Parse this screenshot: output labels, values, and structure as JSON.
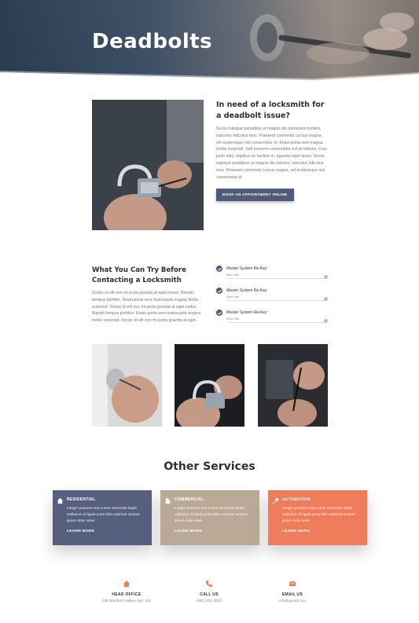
{
  "hero": {
    "title": "Deadbolts"
  },
  "intro": {
    "title": "In need of a locksmith for a deadbolt issue?",
    "body": "Sociis natoque penatibus et magnis dis parturient montes, nascetur ridiculus mus. Praesent commodo cursus magna, vel scelerisque nisl consectetur et. Etiam porta sem magna mollis euismod. Sed posuere consectetur est at lobortis. Cras justo odio, dapibus ac facilisis in, egestas eget quam. Sociis natoque penatibus et magnis dis montes, nascetur ridiculus mus. Praesent commodo cursus magna, vel scelerisque nisl consectetur et.",
    "button_label": "BOOK AN APPOINTMENT ONLINE"
  },
  "try_before": {
    "title": "What You Can Try Before Contacting a Locksmith",
    "body": "Donec id elit non mi porta gravida at eget metus. Blandit tempus porttitor. Etiam porta sem malesuada magna mollis euismod. Donec id elit non mi porta gravida at eget metus. Blandit tempus porttitor. Etiam porta sem malesuada magna mollis euismod. Donec id elit non mi porta gravida at eget."
  },
  "checklist": [
    {
      "label": "Master System Re-Key",
      "sub": "More Info"
    },
    {
      "label": "Master System Re-Key",
      "sub": "More Info"
    },
    {
      "label": "Master System Re-Key",
      "sub": "More Info"
    }
  ],
  "other_services": {
    "title": "Other Services",
    "cards": [
      {
        "title": "RESIDENTIAL",
        "body": "Integer posuere erat a ante venenatis dapib estibulum id ligula porta felis euismod semper ipsum dolor amet",
        "link": "LEARN MORE",
        "icon": "home-icon",
        "color": "#56607e"
      },
      {
        "title": "COMMERCIAL",
        "body": "Integer posuere erat a ante venenatis dapib estibulum id ligula porta felis euismod semper ipsum dolor amet",
        "link": "LEARN MORE",
        "icon": "building-icon",
        "color": "#baa997"
      },
      {
        "title": "AUTOMOTIVE",
        "body": "Integer posuere erat a ante venenatis dapib estibulum id ligula porta felis euismod semper ipsum dolor amet",
        "link": "LEARN MORE",
        "icon": "key-icon",
        "color": "#ef7d5c"
      }
    ]
  },
  "contacts": [
    {
      "title": "HEAD OFFICE",
      "value": "136 Botsford Valleys Apt. 264",
      "icon": "home-icon"
    },
    {
      "title": "CALL US",
      "value": "(451) 321-3522",
      "icon": "phone-icon"
    },
    {
      "title": "EMAIL US",
      "value": "info@gmail.com",
      "icon": "mail-icon"
    }
  ],
  "colors": {
    "accent": "#ef7d5c",
    "primary": "#4f5b7a",
    "tan": "#baa997"
  }
}
